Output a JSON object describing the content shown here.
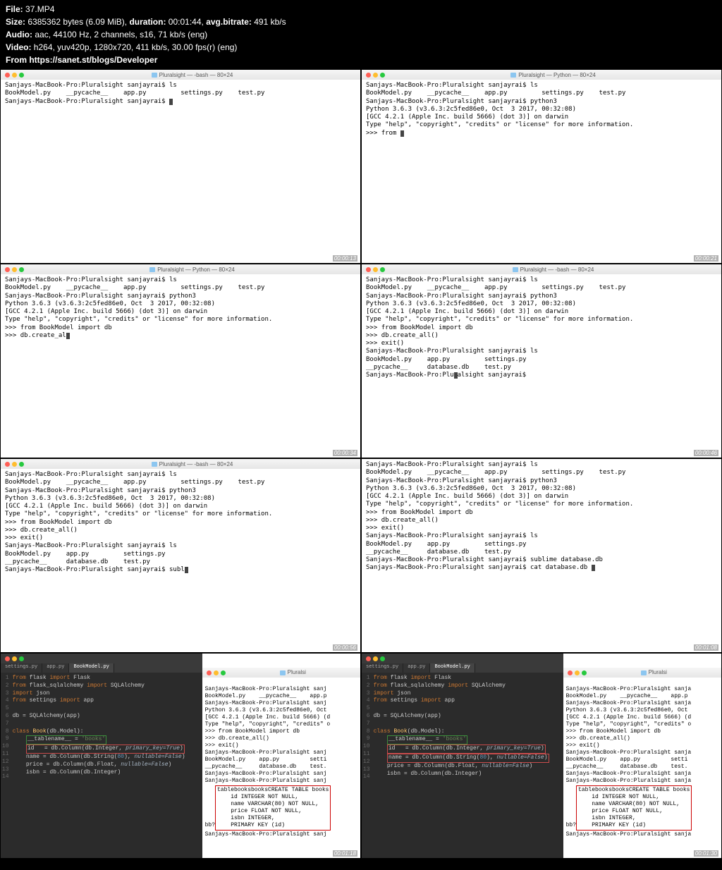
{
  "header": {
    "file_label": "File:",
    "file": "37.MP4",
    "size_label": "Size:",
    "size": "6385362 bytes (6.09 MiB),",
    "duration_label": "duration:",
    "duration": "00:01:44,",
    "bitrate_label": "avg.bitrate:",
    "bitrate": "491 kb/s",
    "audio_label": "Audio:",
    "audio": "aac, 44100 Hz, 2 channels, s16, 71 kb/s (eng)",
    "video_label": "Video:",
    "video": "h264, yuv420p, 1280x720, 411 kb/s, 30.00 fps(r) (eng)",
    "from": "From https://sanet.st/blogs/Developer"
  },
  "titles": {
    "bash": "Pluralsight — -bash — 80×24",
    "python": "Pluralsight — Python — 80×24"
  },
  "timestamps": {
    "t1": "00:00:13",
    "t2": "00:00:21",
    "t3": "00:00:34",
    "t4": "00:00:46",
    "t5": "00:00:56",
    "t6": "00:01:08",
    "t7": "00:01:18",
    "t8": "00:01:30"
  },
  "term": {
    "prompt": "Sanjays-MacBook-Pro:Pluralsight sanjayrai$ ",
    "ls": "ls",
    "ls_out1": "BookModel.py    __pycache__    app.py         settings.py    test.py",
    "python3": "python3",
    "pyver": "Python 3.6.3 (v3.6.3:2c5fed86e0, Oct  3 2017, 00:32:08)",
    "gcc": "[GCC 4.2.1 (Apple Inc. build 5666) (dot 3)] on darwin",
    "help": "Type \"help\", \"copyright\", \"credits\" or \"license\" for more information.",
    "repl": ">>> ",
    "from_partial": "from ",
    "from_full": "from BookModel import db",
    "create_partial": "db.create_al",
    "create_full": "db.create_all()",
    "exit": "exit()",
    "ls_out2a": "BookModel.py    app.py         settings.py",
    "ls_out2b": "__pycache__     database.db    test.py",
    "subl": "subl",
    "sublime_db": "sublime database.db",
    "cat_db": "cat database.db ",
    "prompt_trunc": "Sanjays-MacBook-Pro:Pluralsight sanj",
    "prompt_trunc2": "Sanjays-MacBook-Pro:Pluralsight sanja",
    "pycache_trunc": "BookModel.py    __pycache__    app.p",
    "pyver_trunc": "Python 3.6.3 (v3.6.3:2c5fed86e0, Oct",
    "gcc_trunc": "[GCC 4.2.1 (Apple Inc. build 5666) (d",
    "help_trunc": "Type \"help\", \"copyright\", \"credits\" o",
    "ls2a_trunc": "BookModel.py    app.py         setti",
    "ls2b_trunc": "__pycache__     database.db    test.",
    "bb": "bb?",
    "table_create": "tablebooksbooksCREATE TABLE books",
    "sql1": "id INTEGER NOT NULL,",
    "sql2": "name VARCHAR(80) NOT NULL,",
    "sql3": "price FLOAT NOT NULL,",
    "sql4": "isbn INTEGER,",
    "sql5": "PRIMARY KEY (id)"
  },
  "editor": {
    "tabs": [
      "settings.py",
      "app.py",
      "BookModel.py"
    ],
    "lines": {
      "l1a": "from",
      "l1b": "flask",
      "l1c": "import",
      "l1d": "Flask",
      "l2a": "from",
      "l2b": "flask_sqlalchemy",
      "l2c": "import",
      "l2d": "SQLAlchemy",
      "l3a": "import",
      "l3b": "json",
      "l4a": "from",
      "l4b": "settings",
      "l4c": "import",
      "l4d": "app",
      "l6": "db = SQLAlchemy(app)",
      "l8a": "class",
      "l8b": "Book",
      "l8c": "(db.Model):",
      "l9a": "__tablename__",
      "l9b": "=",
      "l9c": "'books'",
      "l10a": "id",
      "l10b": "= db.Column(db.Integer,",
      "l10c": "primary_key=True",
      "l10d": ")",
      "l11a": "name",
      "l11b": "= db.Column(db.String(",
      "l11c": "80",
      "l11d": "),",
      "l11e": "nullable=False",
      "l11f": ")",
      "l12a": "price",
      "l12b": "= db.Column(db.Float,",
      "l12c": "nullable=False",
      "l12d": ")",
      "l13a": "isbn",
      "l13b": "= db.Column(db.Integer)"
    }
  }
}
